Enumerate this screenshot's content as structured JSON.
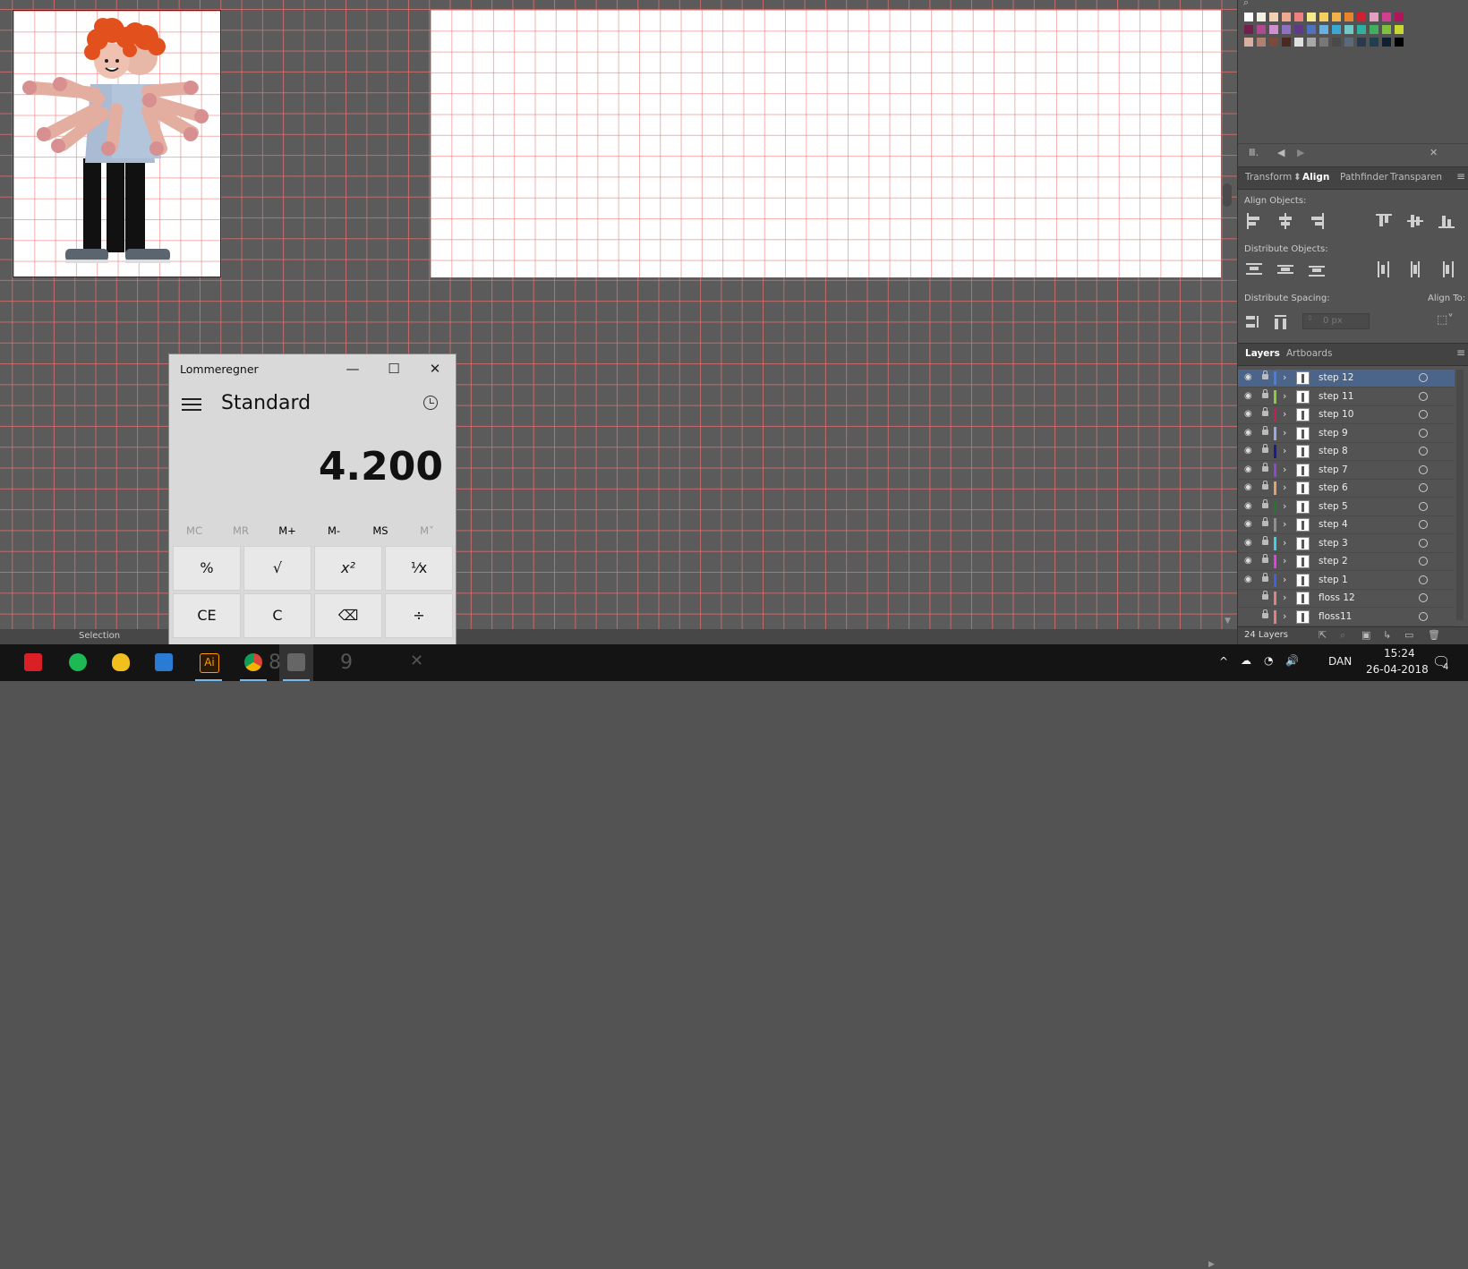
{
  "canvas": {
    "status_text": "Selection"
  },
  "calculator": {
    "title": "Lommeregner",
    "minimize": "—",
    "maximize": "☐",
    "close": "✕",
    "mode": "Standard",
    "display": "4.200",
    "memory": [
      "MC",
      "MR",
      "M+",
      "M-",
      "MS",
      "M˅"
    ],
    "keys_row1": [
      "%",
      "√",
      "x²",
      "¹⁄x"
    ],
    "keys_row2": [
      "CE",
      "C",
      "⌫",
      "÷"
    ]
  },
  "panel": {
    "tabs": [
      "Transform",
      "Align",
      "Pathfinder",
      "Transparen"
    ],
    "align_objects_label": "Align Objects:",
    "distribute_objects_label": "Distribute Objects:",
    "distribute_spacing_label": "Distribute Spacing:",
    "align_to_label": "Align To:",
    "spacing_value": "0 px",
    "layers_tabs": [
      "Layers",
      "Artboards"
    ],
    "layers": [
      {
        "name": "step 12",
        "color": "#4a7de0",
        "selected": true,
        "visible": true
      },
      {
        "name": "step 11",
        "color": "#8acb3a",
        "visible": true
      },
      {
        "name": "step 10",
        "color": "#c22050",
        "visible": true
      },
      {
        "name": "step 9",
        "color": "#9aa6e6",
        "visible": true
      },
      {
        "name": "step 8",
        "color": "#1b1b9a",
        "visible": true
      },
      {
        "name": "step 7",
        "color": "#8a4ad0",
        "visible": true
      },
      {
        "name": "step 6",
        "color": "#e0a070",
        "visible": true
      },
      {
        "name": "step 5",
        "color": "#1f7a2b",
        "visible": true
      },
      {
        "name": "step 4",
        "color": "#909090",
        "visible": true
      },
      {
        "name": "step 3",
        "color": "#40d0e0",
        "visible": true
      },
      {
        "name": "step 2",
        "color": "#e040e0",
        "visible": true
      },
      {
        "name": "step 1",
        "color": "#4060e0",
        "visible": true
      },
      {
        "name": "floss 12",
        "color": "#e08080",
        "visible": false
      },
      {
        "name": "floss11",
        "color": "#e08080",
        "visible": false
      }
    ],
    "layers_count": "24 Layers"
  },
  "swatches": [
    [
      "#ffffff",
      "#f3f0e6",
      "#f2d0b0",
      "#f0a890",
      "#ee8080",
      "#f5e98a",
      "#f5d060",
      "#f2b24a",
      "#e8842c",
      "#d02030",
      "#e2a0c0",
      "#d04090",
      "#b0145a"
    ],
    [
      "#70204a",
      "#b04a90",
      "#d090d0",
      "#9070c0",
      "#603a8a",
      "#5070c0",
      "#6ab0e0",
      "#3aa8d0",
      "#70c8c8",
      "#30b0a0",
      "#40b060",
      "#80c040",
      "#c8d830"
    ],
    [
      "#d8b0a0",
      "#b08070",
      "#7a4a3a",
      "#4a2a20",
      "#e0e0e0",
      "#a8a8a8",
      "#787878",
      "#4a4a4a",
      "#5a6a7a",
      "#2a3a4a",
      "#204050",
      "#102030",
      "#000000"
    ]
  ],
  "taskbar": {
    "language": "DAN",
    "time": "15:24",
    "date": "26-04-2018",
    "notification_count": "4",
    "icons": [
      "creative-cloud-icon",
      "spotify-icon",
      "duck-app-icon",
      "app-icon",
      "illustrator-icon",
      "chrome-icon",
      "calculator-icon"
    ],
    "illustrator_label": "Ai",
    "peek_numbers": [
      "8",
      "9"
    ]
  }
}
